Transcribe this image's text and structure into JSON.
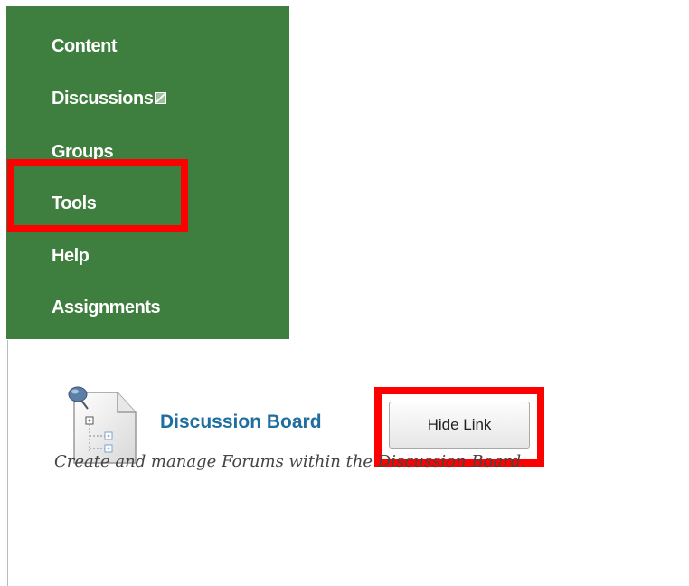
{
  "nav": {
    "items": [
      {
        "label": "Content"
      },
      {
        "label": "Discussions",
        "icon": "external-link-icon"
      },
      {
        "label": "Groups"
      },
      {
        "label": "Tools"
      },
      {
        "label": "Help"
      },
      {
        "label": "Assignments"
      }
    ],
    "background_color": "#3e7e3e",
    "text_color": "#ffffff"
  },
  "tool": {
    "icon": "discussion-board-icon",
    "title": "Discussion Board",
    "hide_button_label": "Hide Link",
    "description": "Create and manage Forums within the Discussion Board.",
    "title_color": "#1f6e9f"
  },
  "annotations": {
    "highlight_color": "#ff0000"
  }
}
